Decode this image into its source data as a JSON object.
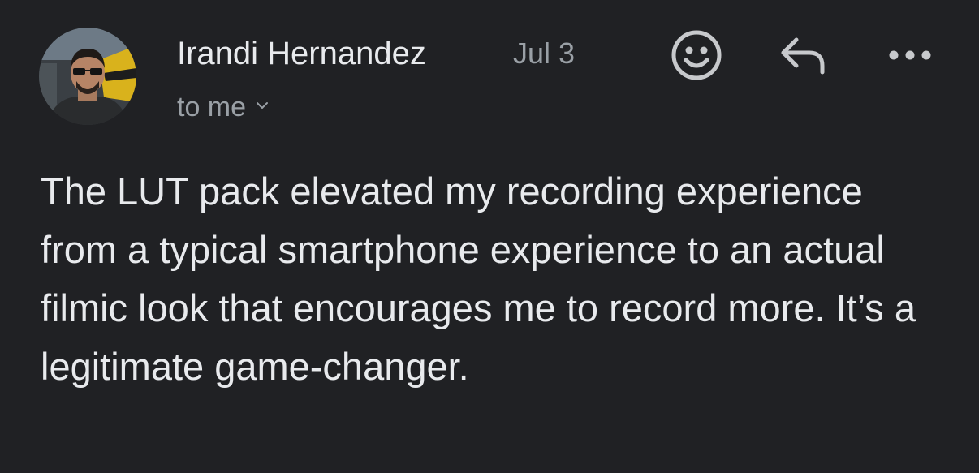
{
  "sender": {
    "name": "Irandi Hernandez",
    "date": "Jul 3",
    "avatar_icon": "avatar-photo"
  },
  "recipient": {
    "label": "to me",
    "expand_icon": "chevron-down-icon"
  },
  "actions": {
    "emoji_icon": "smiley-icon",
    "reply_icon": "reply-arrow-icon",
    "more_icon": "more-dots-icon"
  },
  "message": {
    "body": "The LUT pack elevated my recording experience from a typical smartphone experience to an actual filmic look that encourages me to record more. It’s a legitimate game-changer."
  },
  "colors": {
    "background": "#202124",
    "primary_text": "#e8eaed",
    "secondary_text": "#9aa0a6"
  }
}
